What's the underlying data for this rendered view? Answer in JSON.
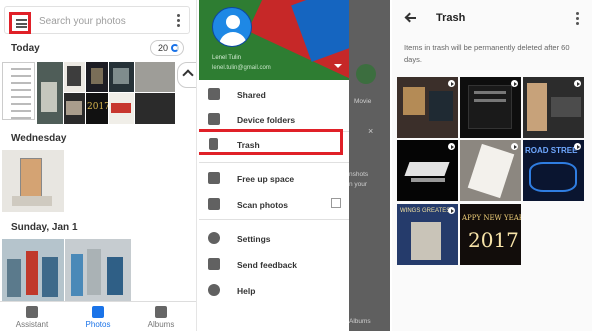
{
  "panel1": {
    "search_placeholder": "Search your photos",
    "today_label": "Today",
    "count_badge": "20",
    "sections": [
      "Wednesday",
      "Sunday, Jan 1"
    ],
    "bottom_nav": [
      "Assistant",
      "Photos",
      "Albums"
    ],
    "thumb_text_2017": "2017"
  },
  "panel2": {
    "header_name": "Lenel Tulin",
    "header_email": "lenel.tulin@gmail.com",
    "items": [
      "Shared",
      "Device folders",
      "Trash",
      "Free up space",
      "Scan photos",
      "Settings",
      "Send feedback",
      "Help"
    ],
    "behind": {
      "movie": "Movie",
      "shots_line1": "nshots",
      "shots_line2": "n your",
      "albums": "Albums"
    }
  },
  "panel3": {
    "title": "Trash",
    "info": "Items in trash will be permanently deleted after 60 days.",
    "tile_texts": {
      "road": "ROAD STREE",
      "wings": "WINGS GREATES",
      "new_year_line1": "APPY NEW YEAR",
      "new_year_line2": "2017"
    }
  },
  "colors": {
    "highlight_red": "#e02028",
    "accent_blue": "#1a73e8"
  }
}
